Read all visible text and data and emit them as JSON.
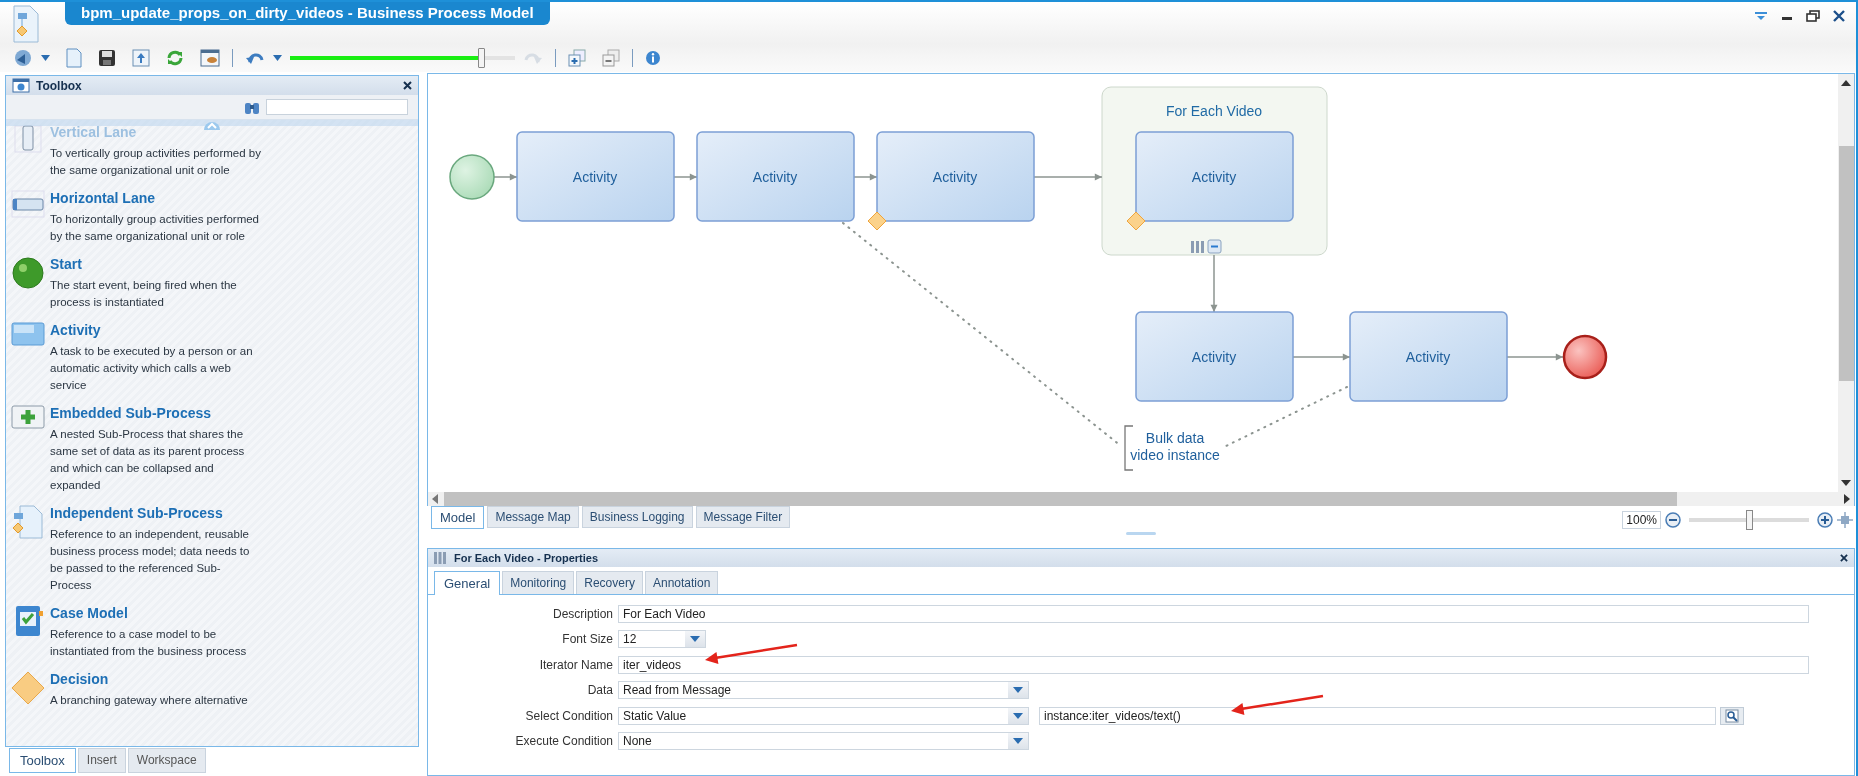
{
  "window": {
    "title": "bpm_update_props_on_dirty_videos - Business Process Model"
  },
  "toolbar": {
    "history_slider": {
      "level": 0.85
    }
  },
  "toolbox": {
    "title": "Toolbox",
    "items": [
      {
        "kind": "vertical_lane",
        "name": "Vertical Lane",
        "description": "To vertically group activities performed by the same organizational unit or role"
      },
      {
        "kind": "horizontal_lane",
        "name": "Horizontal Lane",
        "description": "To horizontally group activities performed by the same organizational unit or role"
      },
      {
        "kind": "start",
        "name": "Start",
        "description": "The start event, being fired when the process is instantiated"
      },
      {
        "kind": "activity",
        "name": "Activity",
        "description": "A task to be executed by a person or an automatic activity which calls a web service"
      },
      {
        "kind": "embedded",
        "name": "Embedded Sub-Process",
        "description": "A nested Sub-Process that shares the same set of data as its parent process and which can be collapsed and expanded"
      },
      {
        "kind": "independent",
        "name": "Independent Sub-Process",
        "description": "Reference to an independent, reusable business process model; data needs to be passed to the referenced Sub-Process"
      },
      {
        "kind": "case",
        "name": "Case Model",
        "description": "Reference to a case model to be instantiated from the business process"
      },
      {
        "kind": "decision",
        "name": "Decision",
        "description": "A branching gateway where alternative"
      }
    ],
    "tabs": [
      {
        "label": "Toolbox",
        "selected": true
      },
      {
        "label": "Insert",
        "selected": false
      },
      {
        "label": "Workspace",
        "selected": false
      }
    ]
  },
  "diagram": {
    "activities": [
      {
        "label": "Activity",
        "boundary_marker": false
      },
      {
        "label": "Activity",
        "boundary_marker": false
      },
      {
        "label": "Activity",
        "boundary_marker": true
      }
    ],
    "loop_group": {
      "title": "For Each Video",
      "activity": {
        "label": "Activity",
        "boundary_marker": true
      }
    },
    "after_loop": [
      {
        "label": "Activity",
        "boundary_marker": false
      },
      {
        "label": "Activity",
        "boundary_marker": false
      }
    ],
    "annotation": [
      "Bulk data",
      "video instance"
    ]
  },
  "model_tabs": [
    {
      "label": "Model",
      "selected": true
    },
    {
      "label": "Message Map",
      "selected": false
    },
    {
      "label": "Business Logging",
      "selected": false
    },
    {
      "label": "Message Filter",
      "selected": false
    }
  ],
  "zoom": {
    "value": "100%",
    "level": 0.5
  },
  "properties": {
    "title": "For Each Video - Properties",
    "tabs": [
      {
        "label": "General",
        "selected": true
      },
      {
        "label": "Monitoring",
        "selected": false
      },
      {
        "label": "Recovery",
        "selected": false
      },
      {
        "label": "Annotation",
        "selected": false
      }
    ],
    "fields": [
      {
        "label": "Description",
        "kind": "text",
        "value": "For Each Video",
        "annotated": false
      },
      {
        "label": "Font Size",
        "kind": "size_select",
        "value": "12",
        "annotated": false
      },
      {
        "label": "Iterator Name",
        "kind": "text",
        "value": "iter_videos",
        "annotated": true
      },
      {
        "label": "Data",
        "kind": "select",
        "value": "Read from Message",
        "annotated": false
      },
      {
        "label": "Select Condition",
        "kind": "select",
        "value": "Static Value",
        "annotated": false,
        "extra": {
          "value": "instance:iter_videos/text()",
          "annotated": true
        }
      },
      {
        "label": "Execute Condition",
        "kind": "select",
        "value": "None",
        "annotated": false
      }
    ]
  }
}
